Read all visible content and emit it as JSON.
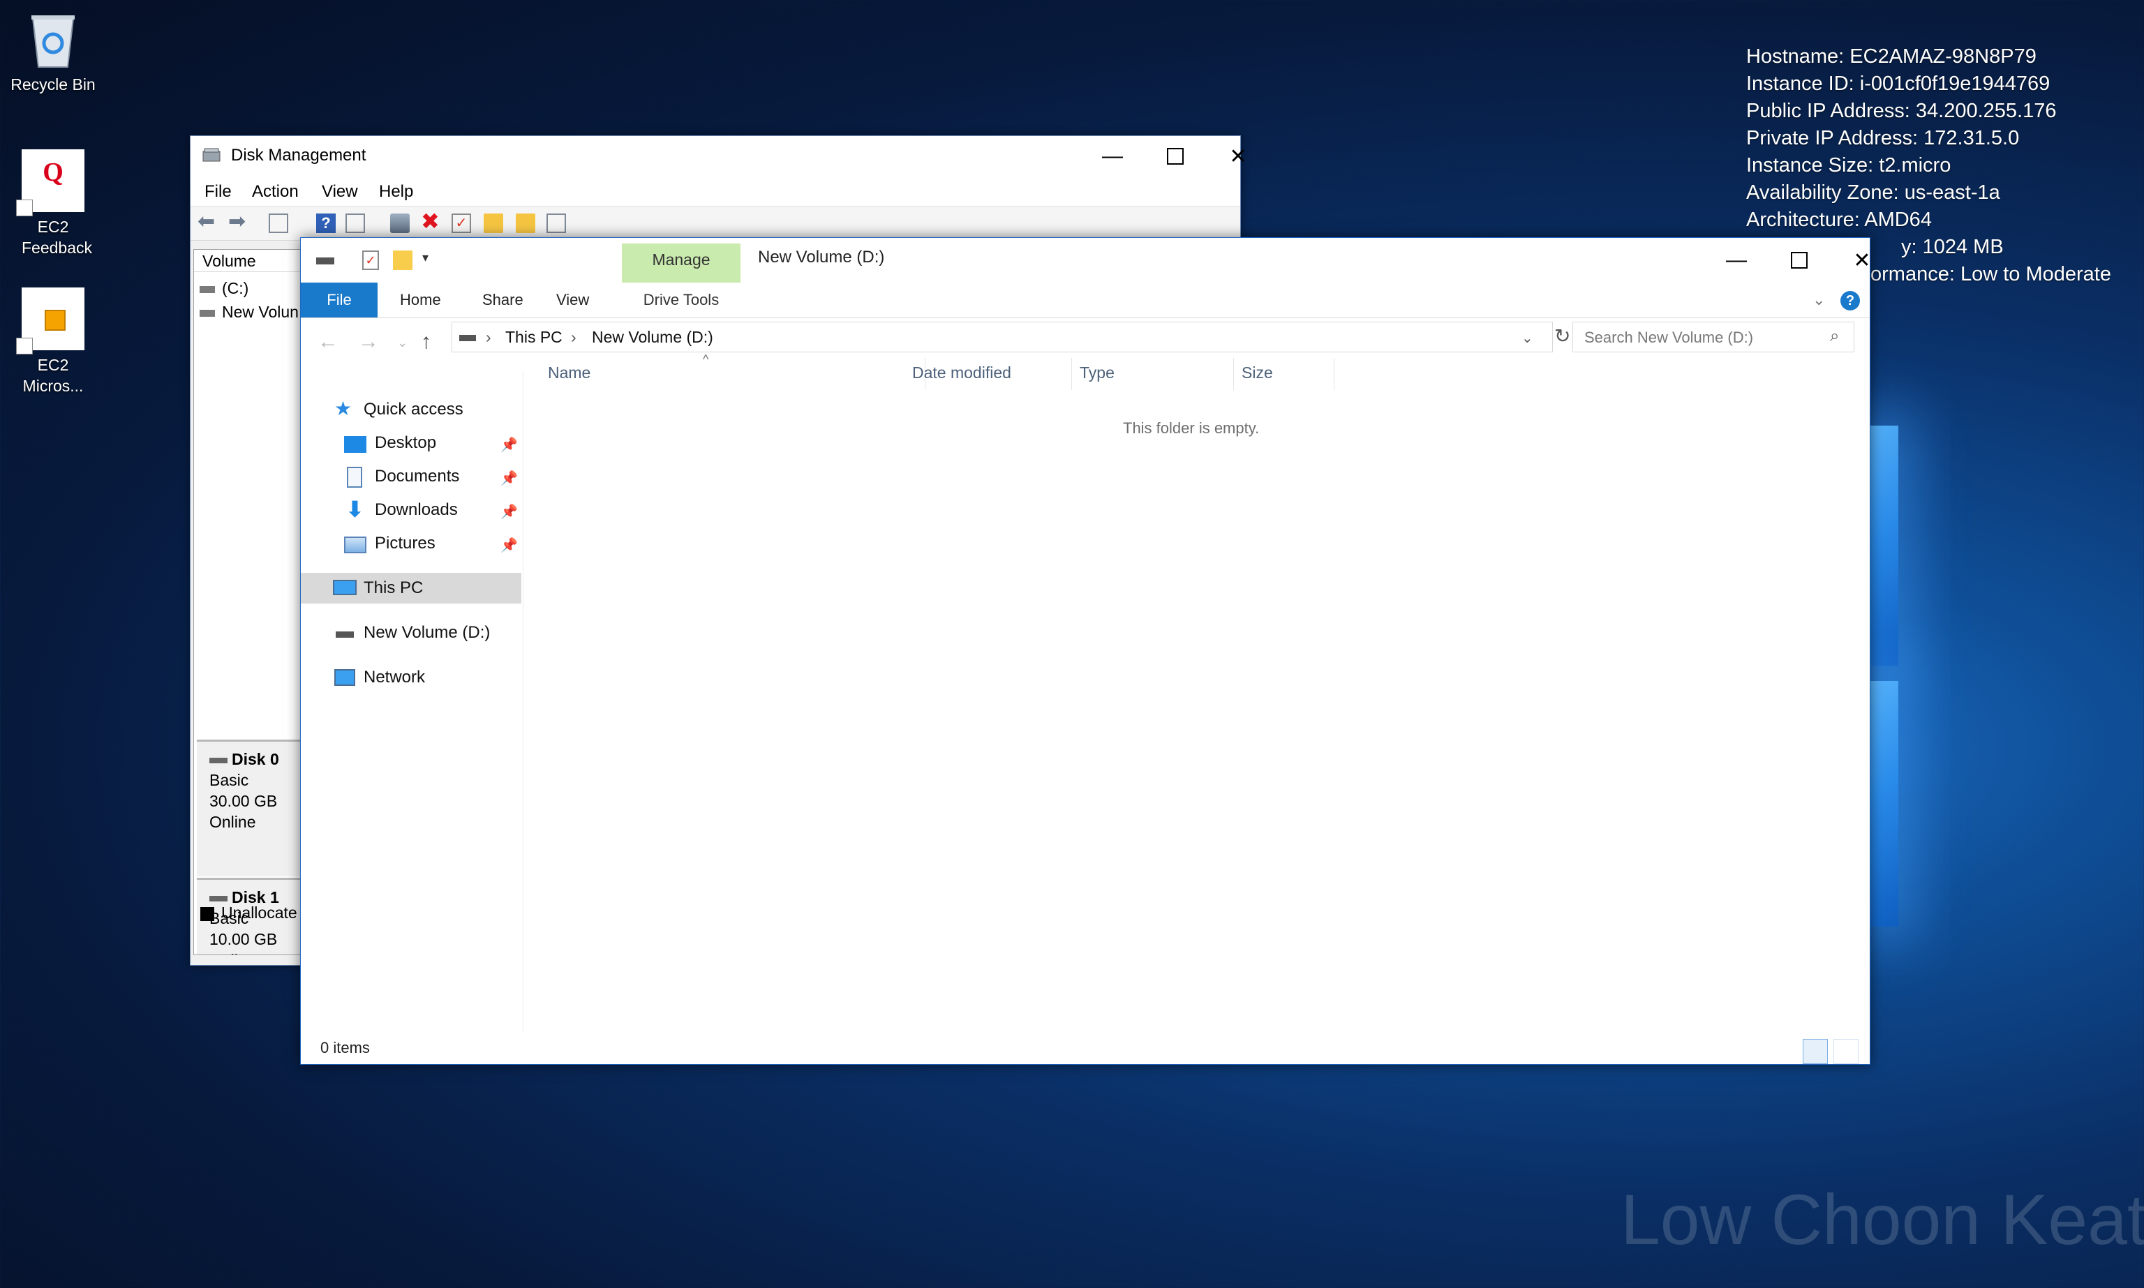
{
  "desktop": {
    "icons": [
      {
        "label": "Recycle Bin"
      },
      {
        "label": "EC2 Feedback"
      },
      {
        "label": "EC2 Micros..."
      }
    ],
    "info_lines": [
      "Hostname: EC2AMAZ-98N8P79",
      "Instance ID: i-001cf0f19e1944769",
      "Public IP Address: 34.200.255.176",
      "Private IP Address: 172.31.5.0",
      "Instance Size: t2.micro",
      "Availability Zone: us-east-1a",
      "Architecture: AMD64",
      "y: 1024 MB",
      "ormance: Low to Moderate"
    ],
    "watermark": "Low Choon Keat"
  },
  "disk_management": {
    "title": "Disk Management",
    "menu": [
      "File",
      "Action",
      "View",
      "Help"
    ],
    "volume_header": "Volume",
    "volumes": [
      "(C:)",
      "New Volun"
    ],
    "disks": [
      {
        "name": "Disk 0",
        "type": "Basic",
        "size": "30.00 GB",
        "status": "Online"
      },
      {
        "name": "Disk 1",
        "type": "Basic",
        "size": "10.00 GB",
        "status": "Online"
      }
    ],
    "unallocated": "Unallocate"
  },
  "explorer": {
    "title": "New Volume (D:)",
    "manage_tab": "Manage",
    "drive_tools": "Drive Tools",
    "ribbon_tabs": [
      "File",
      "Home",
      "Share",
      "View"
    ],
    "address": {
      "root": "This PC",
      "current": "New Volume (D:)"
    },
    "search_placeholder": "Search New Volume (D:)",
    "nav": {
      "quick_access": "Quick access",
      "pinned": [
        "Desktop",
        "Documents",
        "Downloads",
        "Pictures"
      ],
      "this_pc": "This PC",
      "drive": "New Volume (D:)",
      "network": "Network"
    },
    "columns": [
      "Name",
      "Date modified",
      "Type",
      "Size"
    ],
    "empty_message": "This folder is empty.",
    "status": "0 items"
  },
  "colors": {
    "accent": "#1979ca",
    "manage_green": "#c9ebae"
  }
}
